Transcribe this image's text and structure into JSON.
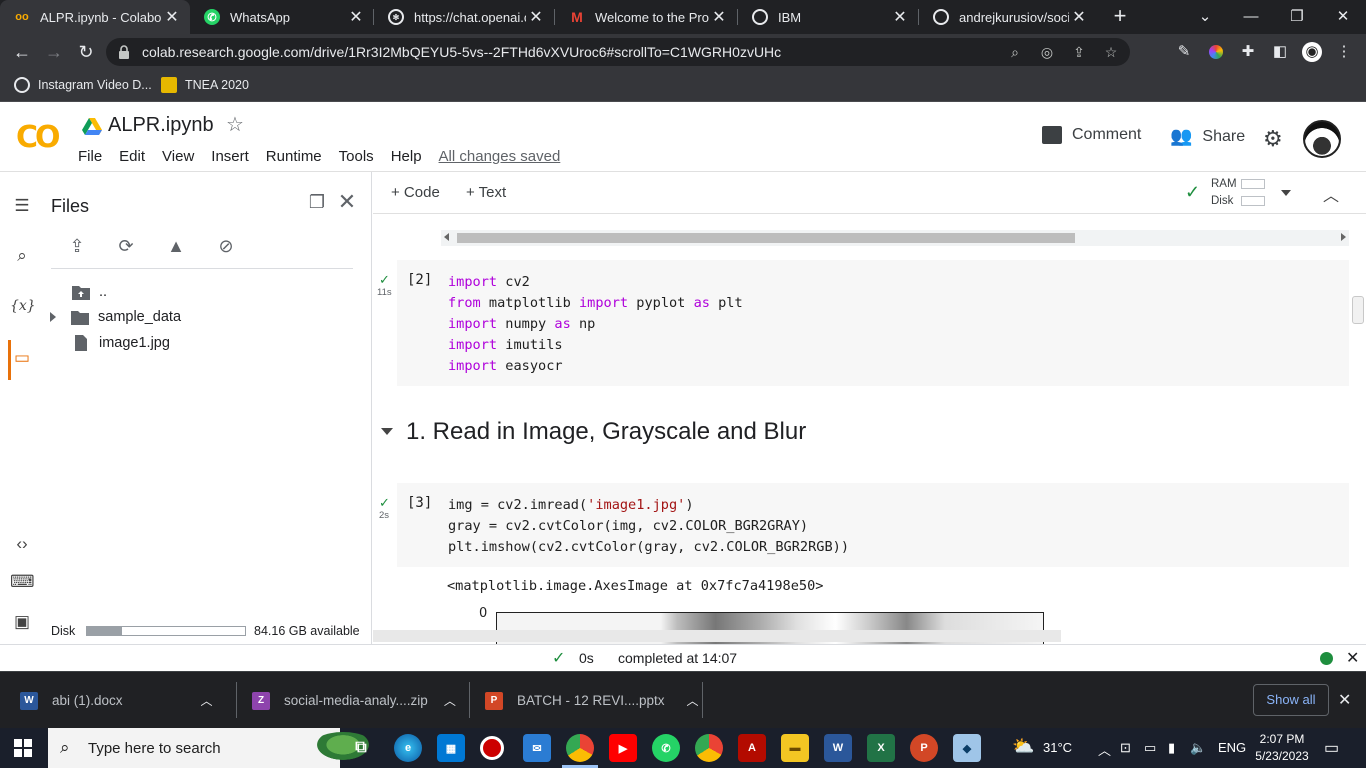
{
  "browser": {
    "tabs": [
      {
        "title": "ALPR.ipynb - Colabora",
        "favicon": "colab-icon",
        "color": "#f9ab00",
        "active": true
      },
      {
        "title": "WhatsApp",
        "favicon": "whatsapp-icon",
        "color": "#25d366",
        "active": false
      },
      {
        "title": "https://chat.openai.co",
        "favicon": "openai-icon",
        "color": "#10a37f",
        "active": false
      },
      {
        "title": "Welcome to the Profe",
        "favicon": "gmail-icon",
        "color": "#ea4335",
        "active": false
      },
      {
        "title": "IBM",
        "favicon": "globe-icon",
        "color": "#e8eaed",
        "active": false
      },
      {
        "title": "andrejkurusiov/social-",
        "favicon": "globe-icon",
        "color": "#e8eaed",
        "active": false
      }
    ],
    "url": "colab.research.google.com/drive/1Rr3I2MbQEYU5-5vs--2FTHd6vXVUroc6#scrollTo=C1WGRH0zvUHc",
    "bookmarks": [
      {
        "label": "Instagram Video D...",
        "icon": "globe-icon"
      },
      {
        "label": "TNEA 2020",
        "icon": "tnea-icon"
      }
    ]
  },
  "colab": {
    "logo": "CO",
    "notebook_title": "ALPR.ipynb",
    "menu": [
      "File",
      "Edit",
      "View",
      "Insert",
      "Runtime",
      "Tools",
      "Help"
    ],
    "saved_status": "All changes saved",
    "comment_label": "Comment",
    "share_label": "Share",
    "add_code_label": "+ Code",
    "add_text_label": "+ Text",
    "ram_label": "RAM",
    "disk_label": "Disk"
  },
  "files_panel": {
    "title": "Files",
    "tree": [
      {
        "label": "..",
        "icon": "folder-up-icon"
      },
      {
        "label": "sample_data",
        "icon": "folder-icon"
      },
      {
        "label": "image1.jpg",
        "icon": "file-icon"
      }
    ],
    "disk_label": "Disk",
    "disk_used_fraction": 0.22,
    "disk_available": "84.16 GB available"
  },
  "cells": {
    "cell2": {
      "exec": "[2]",
      "time": "11s",
      "lines": [
        [
          {
            "t": "import",
            "c": "kw"
          },
          {
            "t": " cv2",
            "c": ""
          }
        ],
        [
          {
            "t": "from",
            "c": "kw"
          },
          {
            "t": " matplotlib ",
            "c": ""
          },
          {
            "t": "import",
            "c": "kw"
          },
          {
            "t": " pyplot ",
            "c": ""
          },
          {
            "t": "as",
            "c": "kw"
          },
          {
            "t": " plt",
            "c": ""
          }
        ],
        [
          {
            "t": "import",
            "c": "kw"
          },
          {
            "t": " numpy ",
            "c": ""
          },
          {
            "t": "as",
            "c": "kw"
          },
          {
            "t": " np",
            "c": ""
          }
        ],
        [
          {
            "t": "import",
            "c": "kw"
          },
          {
            "t": " imutils",
            "c": ""
          }
        ],
        [
          {
            "t": "import",
            "c": "kw"
          },
          {
            "t": " easyocr",
            "c": ""
          }
        ]
      ]
    },
    "section_title": "1. Read in Image, Grayscale and Blur",
    "cell3": {
      "exec": "[3]",
      "time": "2s",
      "lines": [
        [
          {
            "t": "img = cv2.imread(",
            "c": ""
          },
          {
            "t": "'image1.jpg'",
            "c": "str"
          },
          {
            "t": ")",
            "c": ""
          }
        ],
        [
          {
            "t": "gray = cv2.cvtColor(img, cv2.COLOR_BGR2GRAY)",
            "c": ""
          }
        ],
        [
          {
            "t": "plt.imshow(cv2.cvtColor(gray, cv2.COLOR_BGR2RGB))",
            "c": ""
          }
        ]
      ],
      "output": "<matplotlib.image.AxesImage at 0x7fc7a4198e50>",
      "plot_tick": "0"
    }
  },
  "status": {
    "duration": "0s",
    "completed": "completed at 14:07"
  },
  "downloads": [
    {
      "name": "abi (1).docx",
      "icon": "word-icon",
      "color": "#2b579a"
    },
    {
      "name": "social-media-analy....zip",
      "icon": "zip-icon",
      "color": "#8e44ad"
    },
    {
      "name": "BATCH - 12  REVI....pptx",
      "icon": "powerpoint-icon",
      "color": "#d24726"
    }
  ],
  "downloads_show_all": "Show all",
  "taskbar": {
    "search_placeholder": "Type here to search",
    "weather": "31°C",
    "language": "ENG",
    "time": "2:07 PM",
    "date": "5/23/2023"
  }
}
